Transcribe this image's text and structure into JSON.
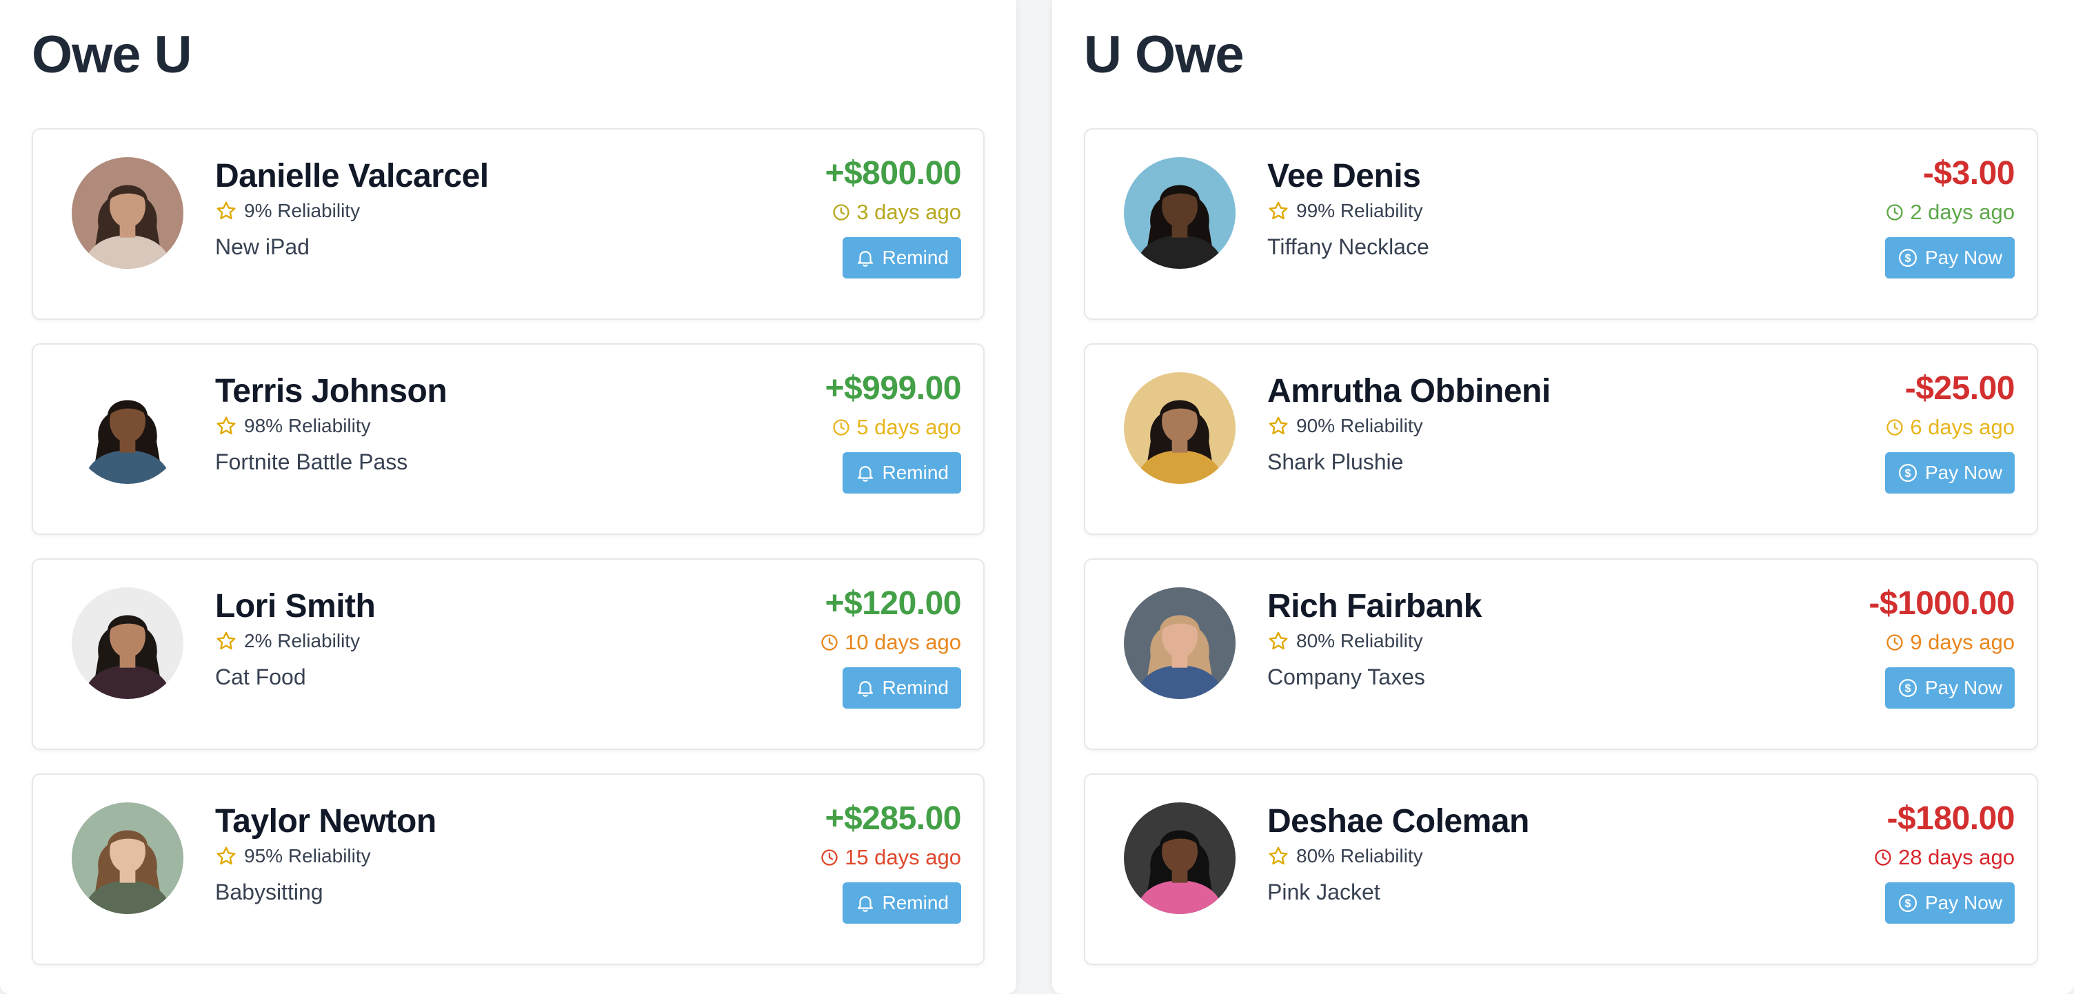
{
  "colors": {
    "positive": "#43a047",
    "negative": "#d32f2f",
    "button": "#5aade3",
    "star": "#e0a800"
  },
  "owe_u": {
    "title": "Owe U",
    "button_label": "Remind",
    "button_icon": "bell-icon",
    "cards": [
      {
        "name": "Danielle Valcarcel",
        "reliability": "9% Reliability",
        "item": "New iPad",
        "amount": "+$800.00",
        "time": "3 days ago",
        "time_color": "#b7a81e",
        "avatar_skin": "#c99b7e",
        "avatar_hair": "#3b2a22",
        "avatar_bg": "#b08a7a",
        "avatar_shirt": "#d8c8bc"
      },
      {
        "name": "Terris Johnson",
        "reliability": "98% Reliability",
        "item": "Fortnite Battle Pass",
        "amount": "+$999.00",
        "time": "5 days ago",
        "time_color": "#e8b51c",
        "avatar_skin": "#7a4e33",
        "avatar_hair": "#1c1410",
        "avatar_bg": "#ffffff",
        "avatar_shirt": "#3c5d78"
      },
      {
        "name": "Lori Smith",
        "reliability": "2% Reliability",
        "item": "Cat Food",
        "amount": "+$120.00",
        "time": "10 days ago",
        "time_color": "#e8871e",
        "avatar_skin": "#b68463",
        "avatar_hair": "#1d1714",
        "avatar_bg": "#ececec",
        "avatar_shirt": "#3a2530"
      },
      {
        "name": "Taylor Newton",
        "reliability": "95% Reliability",
        "item": "Babysitting",
        "amount": "+$285.00",
        "time": "15 days ago",
        "time_color": "#e0482c",
        "avatar_skin": "#e4bfa3",
        "avatar_hair": "#7a5436",
        "avatar_bg": "#9fb6a2",
        "avatar_shirt": "#5c6b55"
      }
    ]
  },
  "u_owe": {
    "title": "U Owe",
    "button_label": "Pay Now",
    "button_icon": "dollar-circle-icon",
    "cards": [
      {
        "name": "Vee Denis",
        "reliability": "99% Reliability",
        "item": "Tiffany Necklace",
        "amount": "-$3.00",
        "time": "2 days ago",
        "time_color": "#5da84a",
        "avatar_skin": "#5b3a26",
        "avatar_hair": "#15100d",
        "avatar_bg": "#7fbcd6",
        "avatar_shirt": "#222222"
      },
      {
        "name": "Amrutha Obbineni",
        "reliability": "90% Reliability",
        "item": "Shark Plushie",
        "amount": "-$25.00",
        "time": "6 days ago",
        "time_color": "#e8b51c",
        "avatar_skin": "#a97a58",
        "avatar_hair": "#1b1411",
        "avatar_bg": "#e6c98a",
        "avatar_shirt": "#d8a23a"
      },
      {
        "name": "Rich Fairbank",
        "reliability": "80% Reliability",
        "item": "Company Taxes",
        "amount": "-$1000.00",
        "time": "9 days ago",
        "time_color": "#e8871e",
        "avatar_skin": "#e2b195",
        "avatar_hair": "#c9a27a",
        "avatar_bg": "#5f6a77",
        "avatar_shirt": "#3f5d8c"
      },
      {
        "name": "Deshae Coleman",
        "reliability": "80% Reliability",
        "item": "Pink Jacket",
        "amount": "-$180.00",
        "time": "28 days ago",
        "time_color": "#d8262c",
        "avatar_skin": "#6b432c",
        "avatar_hair": "#101010",
        "avatar_bg": "#3a3a3a",
        "avatar_shirt": "#e0609a"
      }
    ]
  }
}
